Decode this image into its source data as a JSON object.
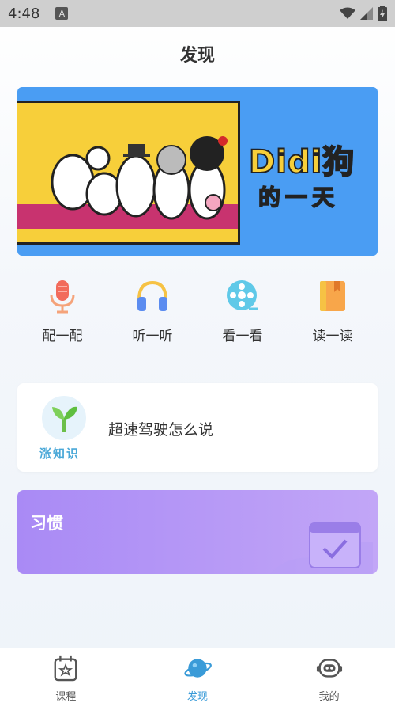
{
  "status_bar": {
    "time": "4:48",
    "a_icon": "A"
  },
  "header": {
    "title": "发现"
  },
  "banner": {
    "title": "Didi狗",
    "subtitle": "的一天"
  },
  "actions": [
    {
      "label": "配一配",
      "icon": "microphone-icon"
    },
    {
      "label": "听一听",
      "icon": "headphones-icon"
    },
    {
      "label": "看一看",
      "icon": "film-reel-icon"
    },
    {
      "label": "读一读",
      "icon": "book-icon"
    }
  ],
  "knowledge_card": {
    "logo_text": "涨知识",
    "text": "超速驾驶怎么说"
  },
  "habit_card": {
    "title": "习惯"
  },
  "tabbar": {
    "items": [
      {
        "label": "课程",
        "icon": "calendar-star-icon"
      },
      {
        "label": "发现",
        "icon": "planet-icon"
      },
      {
        "label": "我的",
        "icon": "robot-face-icon"
      }
    ],
    "active": "发现"
  },
  "colors": {
    "accent": "#3a9bd8",
    "banner_bg": "#4a9df3",
    "habit_card": "#a98af5"
  }
}
